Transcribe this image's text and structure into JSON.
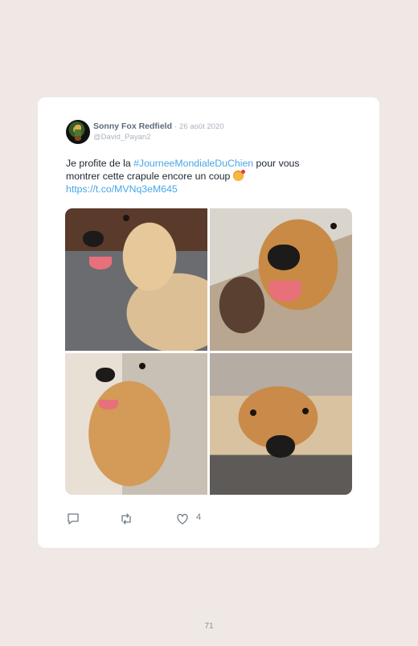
{
  "tweet": {
    "author_name": "Sonny Fox Redfield",
    "separator": "·",
    "date": "26 août 2020",
    "handle": "@David_Payan2",
    "text_before": "Je profite de la ",
    "hashtag": "#JourneeMondialeDuChien",
    "text_after": " pour vous montrer cette crapule encore un coup ",
    "link": "https://t.co/MVNq3eM645",
    "likes_count": "4"
  },
  "icons": [
    "reply-icon",
    "retweet-icon",
    "like-icon"
  ],
  "colors": {
    "link": "#47a6e6",
    "background": "#efe8e4",
    "card": "#ffffff"
  },
  "page_number": "71"
}
